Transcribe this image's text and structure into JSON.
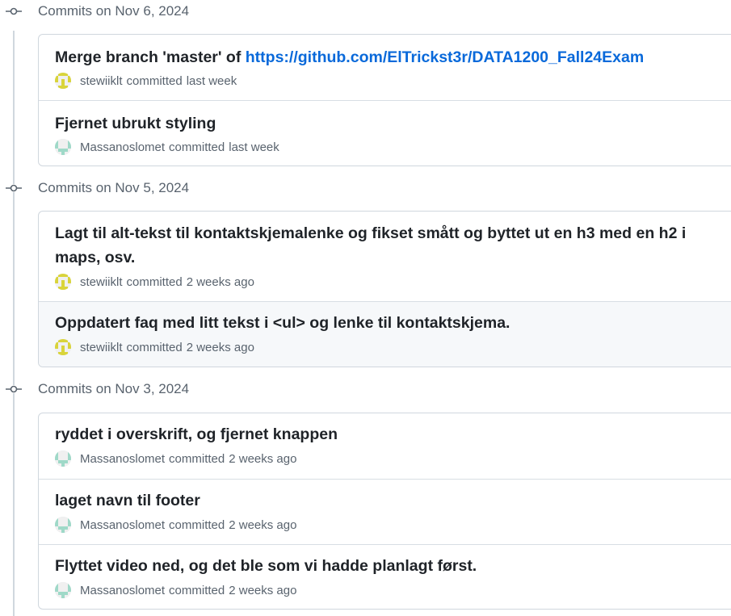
{
  "groups": [
    {
      "title": "Commits on Nov 6, 2024",
      "commits": [
        {
          "message": "Merge branch 'master' of ",
          "link": "https://github.com/ElTrickst3r/DATA1200_Fall24Exam",
          "author": "stewiiklt",
          "action": "committed",
          "time": "last week",
          "avatar": "yellow-identicon"
        },
        {
          "message": "Fjernet ubrukt styling",
          "author": "Massanoslomet",
          "action": "committed",
          "time": "last week",
          "avatar": "mint-identicon"
        }
      ]
    },
    {
      "title": "Commits on Nov 5, 2024",
      "commits": [
        {
          "message": "Lagt til alt-tekst til kontaktskjemalenke og fikset smått og byttet ut en h3 med en h2 i maps, osv.",
          "author": "stewiiklt",
          "action": "committed",
          "time": "2 weeks ago",
          "avatar": "yellow-identicon"
        },
        {
          "message": "Oppdatert faq med litt tekst i <ul> og lenke til kontaktskjema.",
          "author": "stewiiklt",
          "action": "committed",
          "time": "2 weeks ago",
          "avatar": "yellow-identicon"
        }
      ]
    },
    {
      "title": "Commits on Nov 3, 2024",
      "commits": [
        {
          "message": "ryddet i overskrift, og fjernet knappen",
          "author": "Massanoslomet",
          "action": "committed",
          "time": "2 weeks ago",
          "avatar": "mint-identicon"
        },
        {
          "message": "laget navn til footer",
          "author": "Massanoslomet",
          "action": "committed",
          "time": "2 weeks ago",
          "avatar": "mint-identicon"
        },
        {
          "message": "Flyttet video ned, og det ble som vi hadde planlagt først.",
          "author": "Massanoslomet",
          "action": "committed",
          "time": "2 weeks ago",
          "avatar": "mint-identicon"
        }
      ]
    }
  ],
  "colors": {
    "link": "#0969da",
    "muted": "#59636e",
    "border": "#d0d7de",
    "highlight_row": "#f6f8fa",
    "yellow_identicon": "#d9d43a",
    "mint_identicon": "#9fd9c8"
  }
}
